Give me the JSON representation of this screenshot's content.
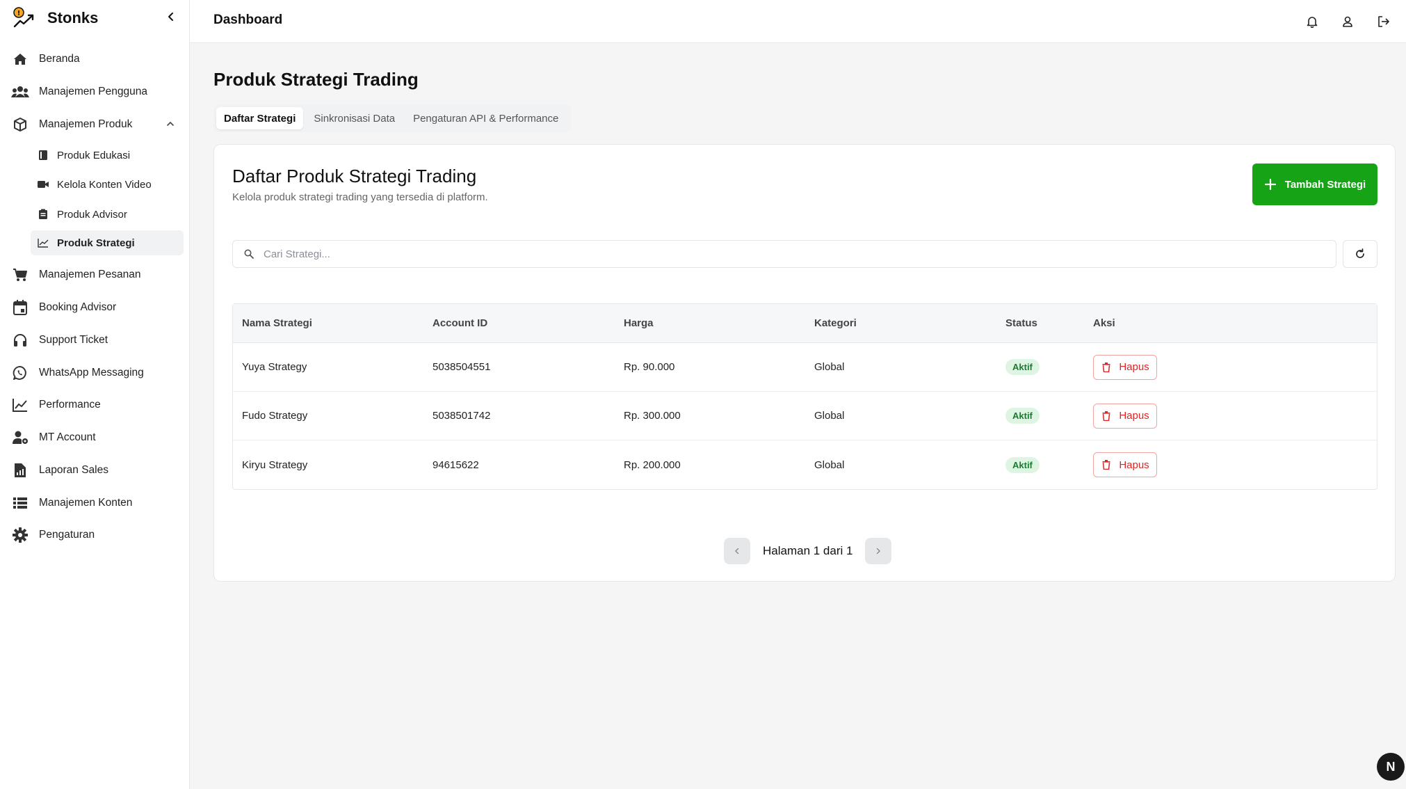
{
  "brand": {
    "name": "Stonks"
  },
  "sidebar": {
    "items": [
      {
        "label": "Beranda",
        "icon": "home-icon"
      },
      {
        "label": "Manajemen Pengguna",
        "icon": "users-icon"
      },
      {
        "label": "Manajemen Produk",
        "icon": "box-icon"
      },
      {
        "label": "Manajemen Pesanan",
        "icon": "cart-icon"
      },
      {
        "label": "Booking Advisor",
        "icon": "calendar-icon"
      },
      {
        "label": "Support Ticket",
        "icon": "headset-icon"
      },
      {
        "label": "WhatsApp Messaging",
        "icon": "whatsapp-icon"
      },
      {
        "label": "Performance",
        "icon": "chart-line-icon"
      },
      {
        "label": "MT Account",
        "icon": "user-gear-icon"
      },
      {
        "label": "Laporan Sales",
        "icon": "report-icon"
      },
      {
        "label": "Manajemen Konten",
        "icon": "list-icon"
      },
      {
        "label": "Pengaturan",
        "icon": "gear-icon"
      }
    ],
    "sub_items": [
      {
        "label": "Produk Edukasi",
        "icon": "book-icon"
      },
      {
        "label": "Kelola Konten Video",
        "icon": "video-icon"
      },
      {
        "label": "Produk Advisor",
        "icon": "clipboard-icon"
      },
      {
        "label": "Produk Strategi",
        "icon": "chart-line-icon"
      }
    ]
  },
  "header": {
    "title": "Dashboard"
  },
  "page": {
    "title": "Produk Strategi Trading",
    "tabs": [
      "Daftar Strategi",
      "Sinkronisasi Data",
      "Pengaturan API & Performance"
    ]
  },
  "card": {
    "title": "Daftar Produk Strategi Trading",
    "subtitle": "Kelola produk strategi trading yang tersedia di platform.",
    "add_button": "Tambah Strategi",
    "search_placeholder": "Cari Strategi..."
  },
  "table": {
    "headers": [
      "Nama Strategi",
      "Account ID",
      "Harga",
      "Kategori",
      "Status",
      "Aksi"
    ],
    "rows": [
      {
        "name": "Yuya Strategy",
        "account_id": "5038504551",
        "price": "Rp. 90.000",
        "category": "Global",
        "status": "Aktif",
        "action": "Hapus"
      },
      {
        "name": "Fudo Strategy",
        "account_id": "5038501742",
        "price": "Rp. 300.000",
        "category": "Global",
        "status": "Aktif",
        "action": "Hapus"
      },
      {
        "name": "Kiryu Strategy",
        "account_id": "94615622",
        "price": "Rp. 200.000",
        "category": "Global",
        "status": "Aktif",
        "action": "Hapus"
      }
    ]
  },
  "pagination": {
    "text": "Halaman 1 dari 1"
  },
  "fab": {
    "label": "N"
  },
  "colors": {
    "accent": "#16a316",
    "danger": "#e02424",
    "badge_bg": "#dff5e3"
  }
}
